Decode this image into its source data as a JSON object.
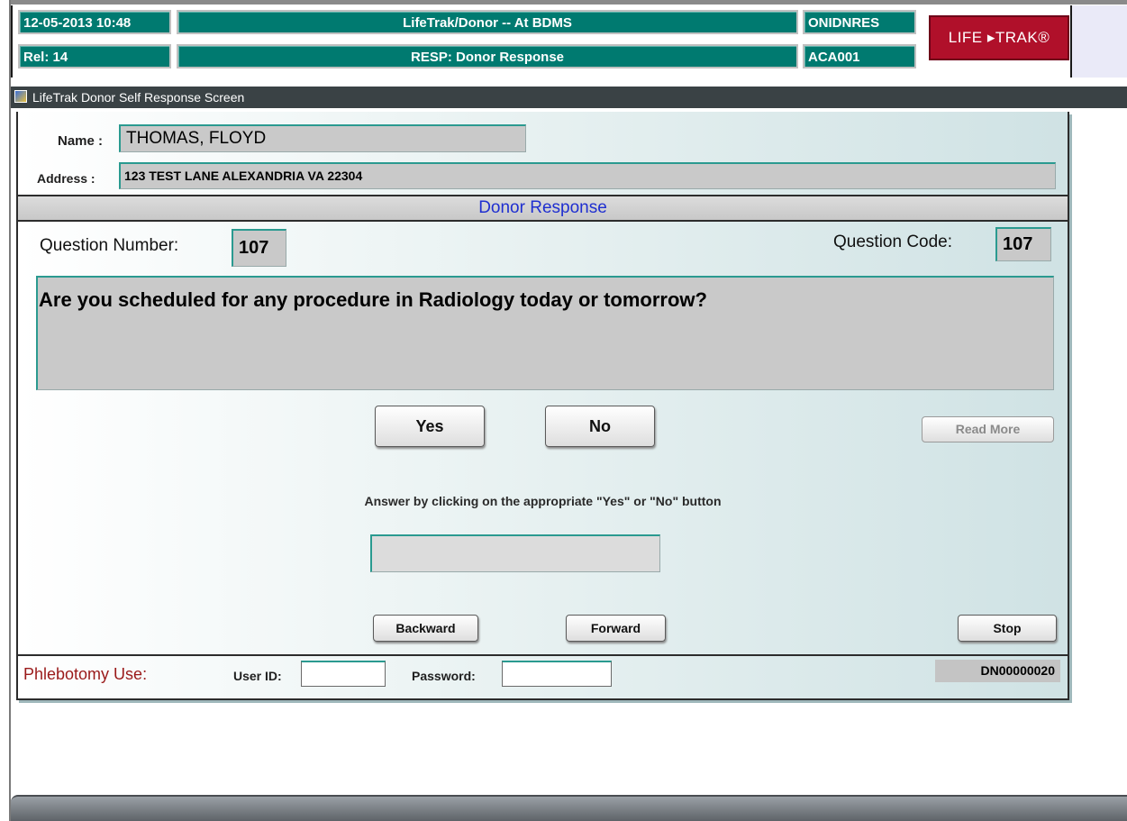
{
  "header": {
    "datetime": "12-05-2013  10:48",
    "release": "Rel: 14",
    "app_title": "LifeTrak/Donor -- At BDMS",
    "screen_title": "RESP: Donor Response",
    "code1": "ONIDNRES",
    "code2": "ACA001",
    "logo_text": "LIFE ▸TRAK®"
  },
  "window": {
    "title": "LifeTrak Donor Self Response Screen"
  },
  "donor": {
    "name_label": "Name :",
    "name_value": "THOMAS, FLOYD",
    "address_label": "Address :",
    "address_value": "123 TEST LANE  ALEXANDRIA VA 22304"
  },
  "section_title": "Donor Response",
  "question": {
    "number_label": "Question Number:",
    "number_value": "107",
    "code_label": "Question Code:",
    "code_value": "107",
    "text": "Are you scheduled for any procedure in Radiology today or tomorrow?"
  },
  "buttons": {
    "yes": "Yes",
    "no": "No",
    "read_more": "Read More",
    "backward": "Backward",
    "forward": "Forward",
    "stop": "Stop"
  },
  "instruction": "Answer by clicking on the appropriate \"Yes\"  or  \"No\" button",
  "answer_value": "",
  "footer": {
    "phlebotomy_label": "Phlebotomy Use:",
    "user_id_label": "User ID:",
    "password_label": "Password:",
    "record_id": "DN00000020"
  },
  "colors": {
    "header_teal": "#007a70",
    "logo_red": "#b0102a",
    "section_blue": "#1f2fd0",
    "phlebotomy_red": "#9a1a1a"
  }
}
